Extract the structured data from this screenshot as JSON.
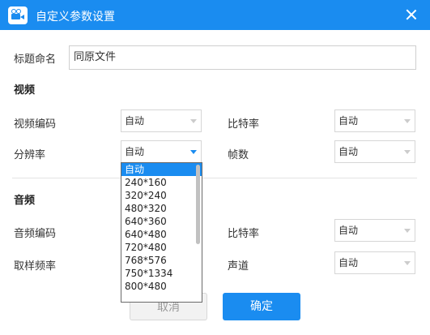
{
  "window": {
    "title": "自定义参数设置",
    "accent_color": "#1a8cf0"
  },
  "title_field": {
    "label": "标题命名",
    "value": "同原文件"
  },
  "video": {
    "section_label": "视频",
    "codec": {
      "label": "视频编码",
      "value": "自动"
    },
    "bitrate": {
      "label": "比特率",
      "value": "自动"
    },
    "resolution": {
      "label": "分辨率",
      "value": "自动",
      "options": [
        "自动",
        "240*160",
        "320*240",
        "480*320",
        "640*360",
        "640*480",
        "720*480",
        "768*576",
        "750*1334",
        "800*480"
      ]
    },
    "framerate": {
      "label": "帧数",
      "value": "自动"
    }
  },
  "audio": {
    "section_label": "音频",
    "codec": {
      "label": "音频编码"
    },
    "bitrate": {
      "label": "比特率",
      "value": "自动"
    },
    "sample_rate": {
      "label": "取样频率"
    },
    "channel": {
      "label": "声道",
      "value": "自动"
    }
  },
  "buttons": {
    "cancel": "取消",
    "ok": "确定"
  }
}
